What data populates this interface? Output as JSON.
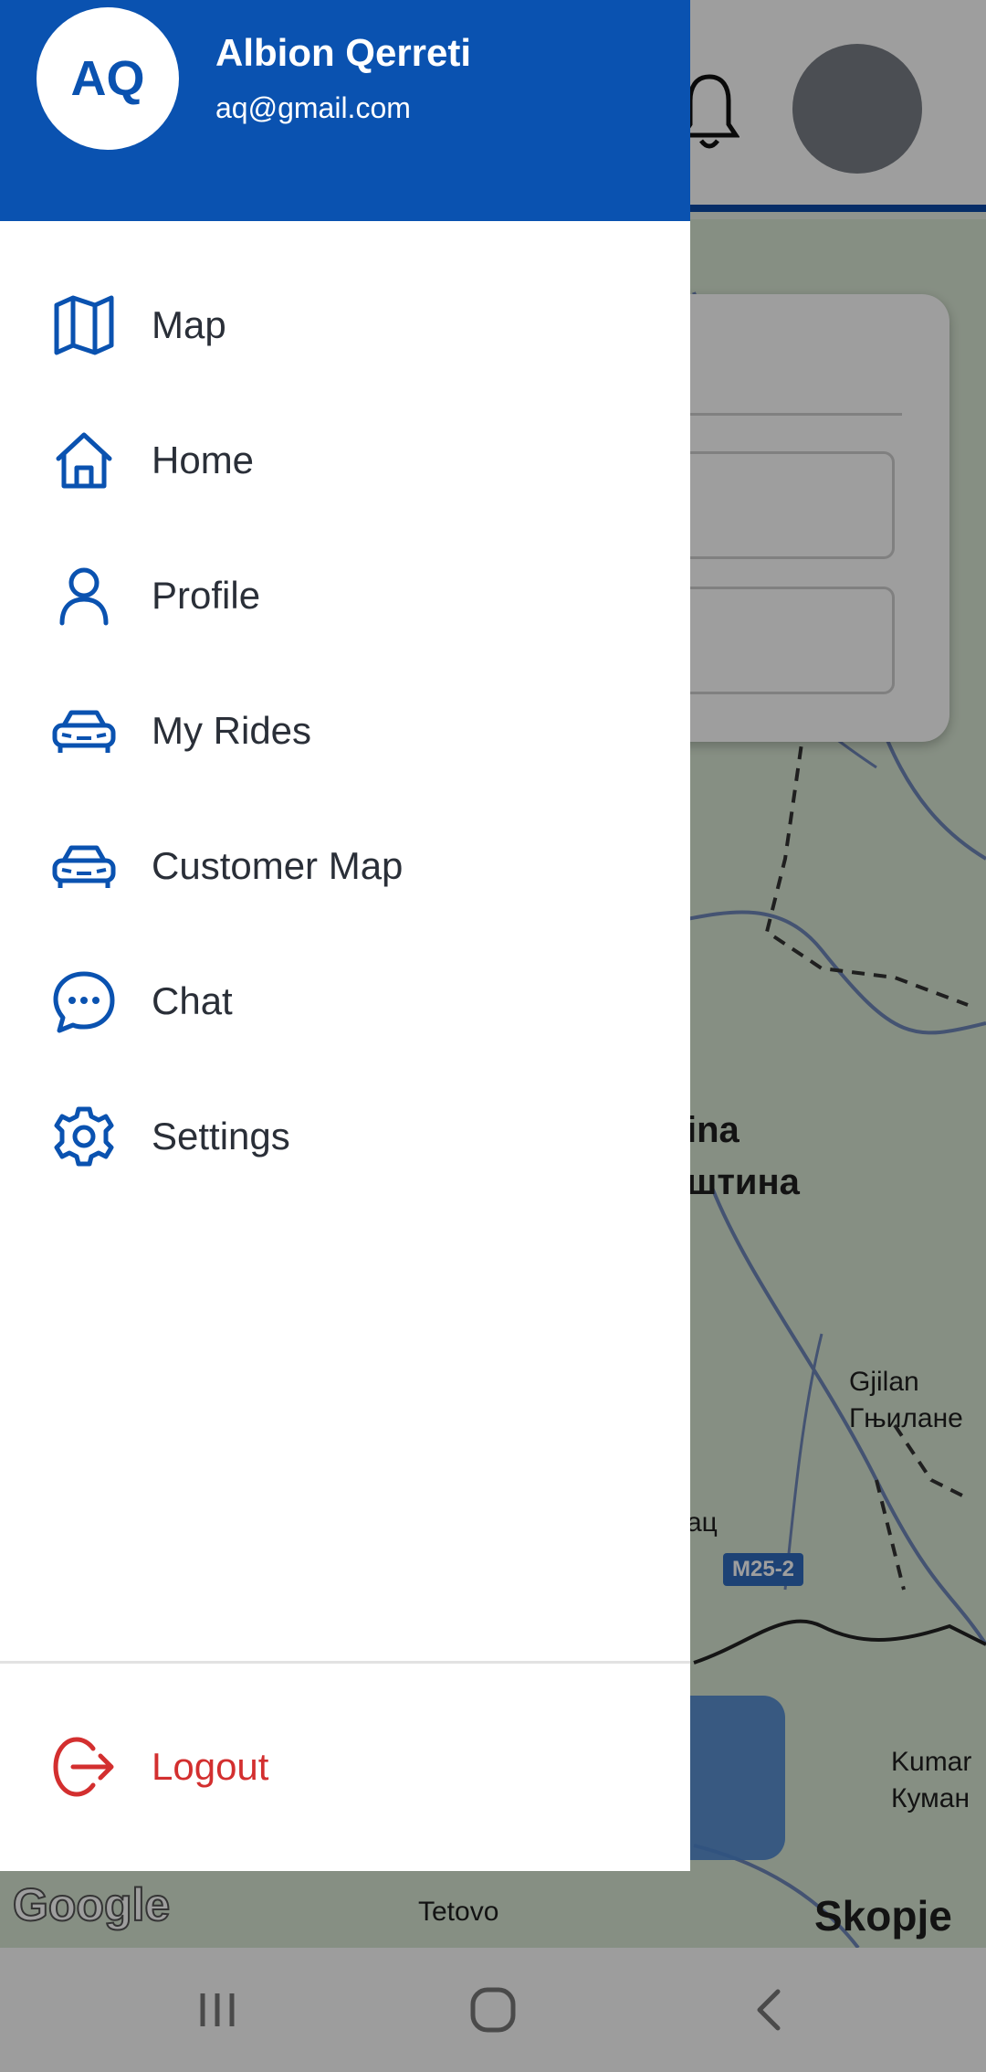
{
  "drawer": {
    "avatar_initials": "AQ",
    "user_name": "Albion Qerreti",
    "user_email": "aq@gmail.com",
    "items": [
      {
        "label": "Map",
        "icon": "map-icon"
      },
      {
        "label": "Home",
        "icon": "home-icon"
      },
      {
        "label": "Profile",
        "icon": "person-icon"
      },
      {
        "label": "My Rides",
        "icon": "car-icon"
      },
      {
        "label": "Customer Map",
        "icon": "car-icon"
      },
      {
        "label": "Chat",
        "icon": "chat-bubble-icon"
      },
      {
        "label": "Settings",
        "icon": "gear-icon"
      }
    ],
    "logout_label": "Logout",
    "logout_icon": "logout-icon"
  },
  "map": {
    "labels": {
      "pristina_latin": "ina",
      "pristina_cyrillic": "штина",
      "road_shield": "M25-2",
      "gjilan_latin": "Gjilan",
      "gjilan_cyrillic": "Гњилане",
      "ferizaj_partial": "ац",
      "kumanovo_latin": "Kumar",
      "kumanovo_cyrillic": "Куман",
      "tetovo": "Tetovo",
      "skopje": "Skopje"
    },
    "attribution": "Google"
  },
  "colors": {
    "primary": "#0a52b0",
    "logout": "#d32f2f",
    "text": "#2a2f38"
  }
}
